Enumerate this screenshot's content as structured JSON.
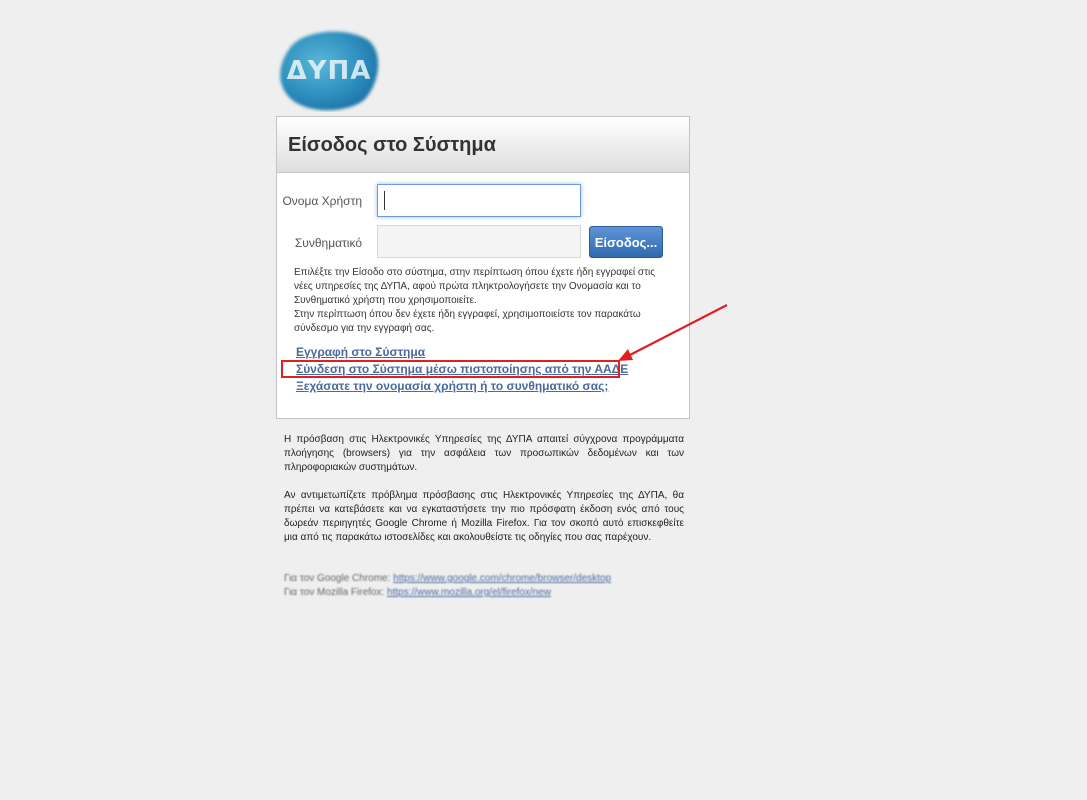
{
  "logo": {
    "text": "ΔΥΠΑ",
    "colors": [
      "#2e8fbf",
      "#5ab7d8",
      "#1b6d9f"
    ]
  },
  "panel": {
    "title": "Είσοδος στο Σύστημα",
    "username_label": "Ονομα Χρήστη",
    "password_label": "Συνθηματικό",
    "username_value": "",
    "password_value": "",
    "login_button": "Είσοδος...",
    "info_lines": [
      "Επιλέξτε την Είσοδο στο σύστημα, στην περίπτωση όπου έχετε ήδη εγγραφεί στις νέες υπηρεσίες της ΔΥΠΑ, αφού πρώτα πληκτρολογήσετε την Ονομασία και το Συνθηματικό χρήστη που χρησιμοποιείτε.",
      "Στην περίπτωση όπου δεν έχετε ήδη εγγραφεί, χρησιμοποιείστε τον παρακάτω σύνδεσμο για την εγγραφή σας."
    ],
    "links": {
      "register": "Εγγραφή στο Σύστημα",
      "aade_login": "Σύνδεση στο Σύστημα μέσω πιστοποίησης από την ΑΑΔΕ",
      "forgot": "Ξεχάσατε την ονομασία χρήστη ή το συνθηματικό σας;"
    }
  },
  "notice": {
    "paragraph1": "Η πρόσβαση στις Ηλεκτρονικές Υπηρεσίες της ΔΥΠΑ απαιτεί σύγχρονα προγράμματα πλοήγησης (browsers) για την ασφάλεια των προσωπικών δεδομένων και των πληροφοριακών συστημάτων.",
    "paragraph2": "Αν αντιμετωπίζετε πρόβλημα πρόσβασης στις Ηλεκτρονικές Υπηρεσίες της ΔΥΠΑ, θα πρέπει να κατεβάσετε και να εγκαταστήσετε την πιο πρόσφατη έκδοση ενός από τους δωρεάν περιηγητές Google Chrome ή Mozilla Firefox. Για τον σκοπό αυτό επισκεφθείτε μια από τις παρακάτω ιστοσελίδες και ακολουθείστε τις οδηγίες που σας παρέχουν.",
    "chrome_label": "Για τον Google Chrome:",
    "chrome_url": "https://www.google.com/chrome/browser/desktop",
    "firefox_label": "Για τον Mozilla Firefox:",
    "firefox_url": "https://www.mozilla.org/el/firefox/new"
  },
  "annotation": {
    "highlight_color": "#e02020"
  }
}
